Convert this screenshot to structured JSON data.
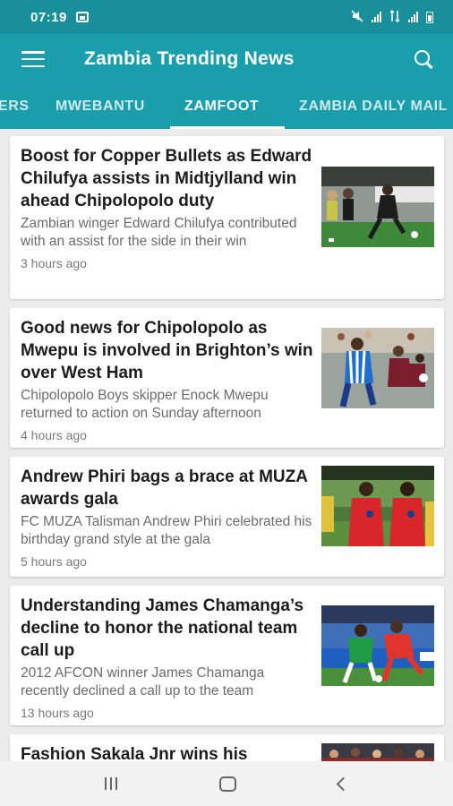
{
  "status_bar": {
    "time": "07:19"
  },
  "app_bar": {
    "title": "Zambia Trending News"
  },
  "tabs": [
    {
      "label": "ERS"
    },
    {
      "label": "MWEBANTU"
    },
    {
      "label": "ZAMFOOT",
      "active": true
    },
    {
      "label": "ZAMBIA DAILY MAIL"
    }
  ],
  "articles": [
    {
      "title": "Boost for Copper Bullets as Edward Chilufya assists in Midtjylland win ahead Chipolopolo duty",
      "summary": "Zambian winger Edward Chilufya contributed with an assist for the side in their win",
      "time": "3 hours ago"
    },
    {
      "title": "Good news for Chipolopolo as Mwepu is involved in Brighton’s win over West Ham",
      "summary": "Chipolopolo Boys skipper Enock Mwepu returned to action on Sunday afternoon",
      "time": "4 hours ago"
    },
    {
      "title": "Andrew Phiri bags a brace at MUZA awards gala",
      "summary": "FC MUZA Talisman Andrew Phiri celebrated his birthday grand style at the gala",
      "time": "5 hours ago"
    },
    {
      "title": "Understanding James Chamanga’s decline to honor the national team call up",
      "summary": "2012 AFCON winner James Chamanga recently declined a call up to the team",
      "time": "13 hours ago"
    },
    {
      "title": "Fashion Sakala Jnr wins his",
      "summary": "",
      "time": ""
    }
  ],
  "colors": {
    "app_bar": "#1a9eab",
    "status_bar": "#1a8f9c",
    "background": "#ebebeb"
  },
  "icons": {
    "menu": "hamburger-menu-icon",
    "search": "search-icon",
    "nav_recent": "recent-apps-icon",
    "nav_home": "home-icon",
    "nav_back": "back-icon"
  }
}
